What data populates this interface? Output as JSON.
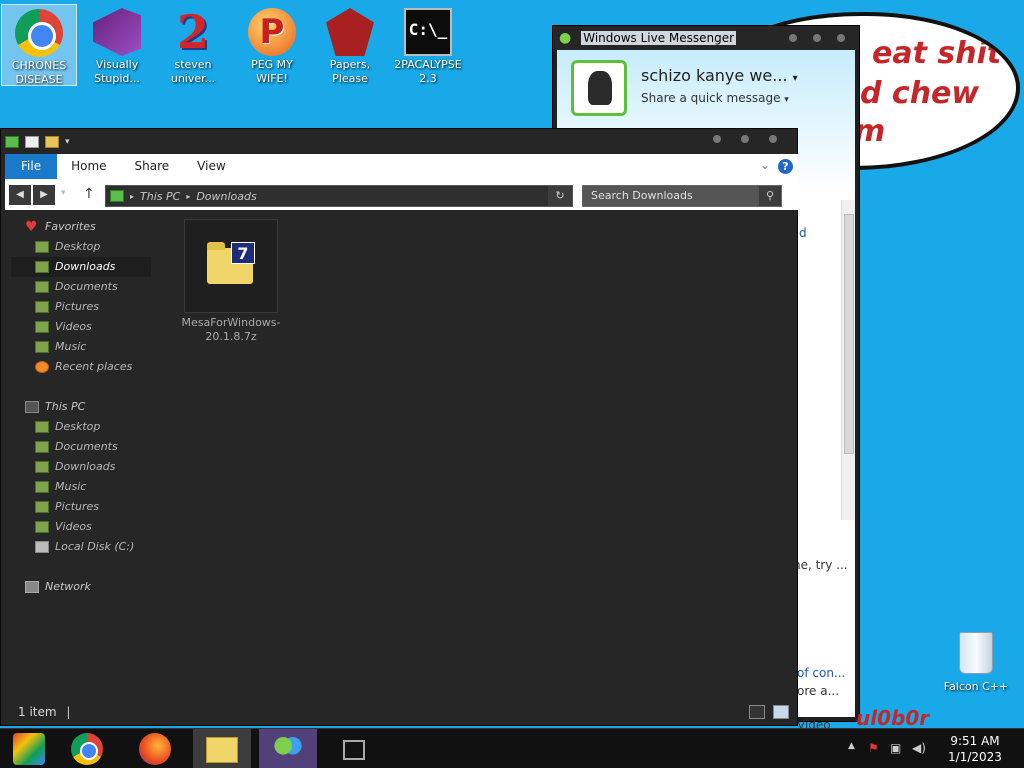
{
  "desktop": {
    "icons": [
      {
        "label": "CHRONES DISEASE",
        "icon": "chrome-icon"
      },
      {
        "label": "Visually Stupid...",
        "icon": "visual-studio-icon"
      },
      {
        "label": "steven univer...",
        "icon": "steven-universe-icon"
      },
      {
        "label": "PEG MY WIFE!",
        "icon": "peggle-icon"
      },
      {
        "label": "Papers, Please",
        "icon": "papers-please-icon"
      },
      {
        "label": "2PACALYPSE 2.3",
        "icon": "command-prompt-icon"
      }
    ],
    "recycle_bin_label": "Falcon C++",
    "bubble_lines": [
      "eat shit",
      "d chew",
      "m"
    ],
    "graffiti": "ul0b0r"
  },
  "messenger": {
    "title": "Windows Live Messenger",
    "display_name": "schizo kanye we...",
    "status_message": "Share a quick message",
    "side_text": [
      "d",
      "ne, try ...",
      "of con...",
      "ore a...",
      "Video"
    ]
  },
  "explorer": {
    "ribbon_tabs": [
      "File",
      "Home",
      "Share",
      "View"
    ],
    "address": [
      "This PC",
      "Downloads"
    ],
    "search_placeholder": "Search Downloads",
    "favorites": {
      "header": "Favorites",
      "items": [
        "Desktop",
        "Downloads",
        "Documents",
        "Pictures",
        "Videos",
        "Music",
        "Recent places"
      ]
    },
    "this_pc": {
      "header": "This PC",
      "items": [
        "Desktop",
        "Documents",
        "Downloads",
        "Music",
        "Pictures",
        "Videos",
        "Local Disk (C:)"
      ]
    },
    "network": "Network",
    "file": {
      "name": "MesaForWindows-20.1.8.7z",
      "icon": "7zip-archive-icon"
    },
    "status": "1 item"
  },
  "taskbar": {
    "items": [
      "start-icon",
      "chrome-icon",
      "firefox-icon",
      "file-explorer-icon",
      "messenger-icon",
      "teamviewer-icon"
    ],
    "time": "9:51 AM",
    "date": "1/1/2023"
  }
}
